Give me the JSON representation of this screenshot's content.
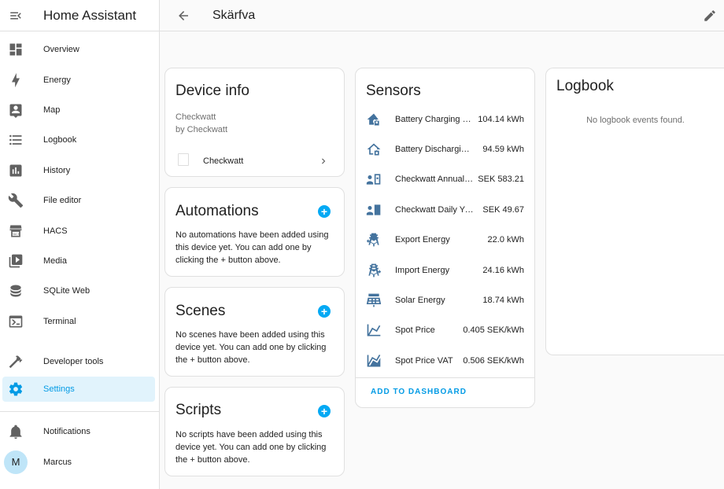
{
  "app": {
    "title": "Home Assistant"
  },
  "sidebar": {
    "items": [
      {
        "label": "Overview",
        "icon": "dashboard-icon"
      },
      {
        "label": "Energy",
        "icon": "lightning-icon"
      },
      {
        "label": "Map",
        "icon": "map-icon"
      },
      {
        "label": "Logbook",
        "icon": "list-icon"
      },
      {
        "label": "History",
        "icon": "chart-icon"
      },
      {
        "label": "File editor",
        "icon": "wrench-icon"
      },
      {
        "label": "HACS",
        "icon": "hacs-icon"
      },
      {
        "label": "Media",
        "icon": "media-icon"
      },
      {
        "label": "SQLite Web",
        "icon": "database-icon"
      },
      {
        "label": "Terminal",
        "icon": "terminal-icon"
      }
    ],
    "tools": [
      {
        "label": "Developer tools",
        "icon": "hammer-icon"
      },
      {
        "label": "Settings",
        "icon": "gear-icon",
        "selected": true
      }
    ],
    "footer": {
      "notifications": "Notifications",
      "user": "Marcus",
      "user_initial": "M"
    }
  },
  "header": {
    "title": "Skärfva"
  },
  "device_info": {
    "title": "Device info",
    "model": "Checkwatt",
    "manufacturer": "by Checkwatt",
    "link_label": "Checkwatt"
  },
  "automations": {
    "title": "Automations",
    "empty": "No automations have been added using this device yet. You can add one by clicking the + button above."
  },
  "scenes": {
    "title": "Scenes",
    "empty": "No scenes have been added using this device yet. You can add one by clicking the + button above."
  },
  "scripts": {
    "title": "Scripts",
    "empty": "No scripts have been added using this device yet. You can add one by clicking the + button above."
  },
  "sensors": {
    "title": "Sensors",
    "rows": [
      {
        "name": "Battery Charging Energy",
        "value": "104.14 kWh",
        "icon": "home-battery-icon"
      },
      {
        "name": "Battery Discharging Energy",
        "value": "94.59 kWh",
        "icon": "home-battery-outline-icon"
      },
      {
        "name": "Checkwatt Annual Yield",
        "value": "SEK 583.21",
        "icon": "account-cash-icon"
      },
      {
        "name": "Checkwatt Daily Yield",
        "value": "SEK 49.67",
        "icon": "account-cash-icon"
      },
      {
        "name": "Export Energy",
        "value": "22.0 kWh",
        "icon": "transmission-tower-export-icon"
      },
      {
        "name": "Import Energy",
        "value": "24.16 kWh",
        "icon": "transmission-tower-import-icon"
      },
      {
        "name": "Solar Energy",
        "value": "18.74 kWh",
        "icon": "solar-power-icon"
      },
      {
        "name": "Spot Price",
        "value": "0.405 SEK/kWh",
        "icon": "chart-line-icon"
      },
      {
        "name": "Spot Price VAT",
        "value": "0.506 SEK/kWh",
        "icon": "chart-areaspline-icon"
      }
    ],
    "add_to_dashboard": "ADD TO DASHBOARD"
  },
  "logbook": {
    "title": "Logbook",
    "empty": "No logbook events found."
  },
  "colors": {
    "accent": "#03a9f4",
    "icon": "#44739e",
    "sidebar_selected_bg": "#e1f3fc"
  }
}
